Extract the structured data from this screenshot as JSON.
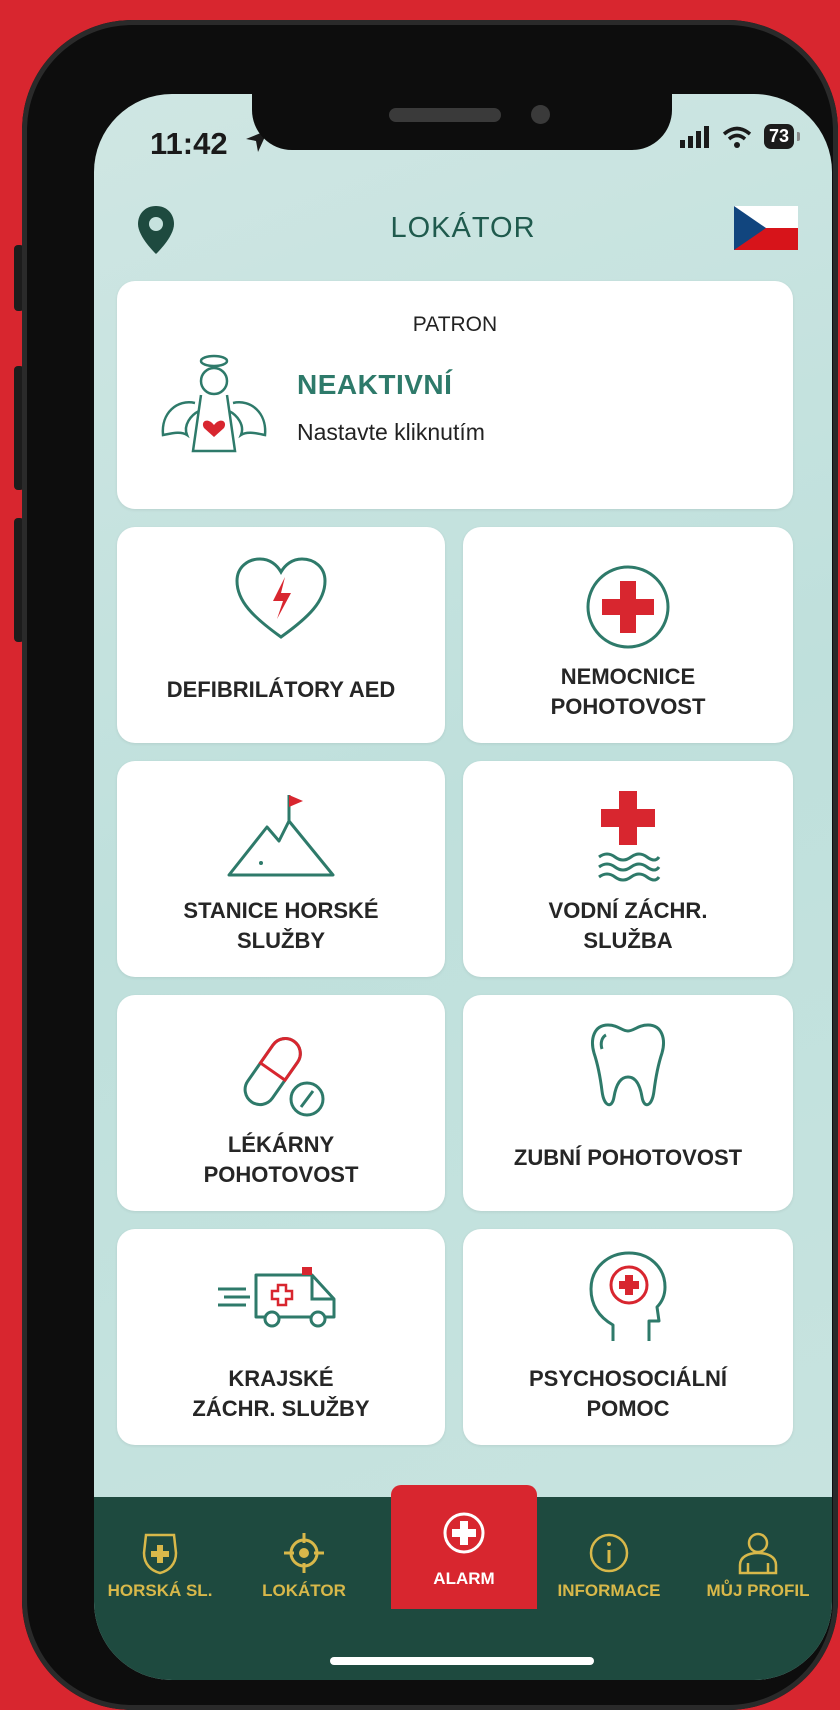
{
  "status": {
    "time": "11:42",
    "battery": "73"
  },
  "header": {
    "title": "LOKÁTOR"
  },
  "patron": {
    "title": "PATRON",
    "state": "NEAKTIVNÍ",
    "hint": "Nastavte kliknutím"
  },
  "tiles": [
    {
      "label": "DEFIBRILÁTORY AED"
    },
    {
      "label": "NEMOCNICE\nPOHOTOVOST"
    },
    {
      "label": "STANICE HORSKÉ\nSLUŽBY"
    },
    {
      "label": "VODNÍ ZÁCHR.\nSLUŽBA"
    },
    {
      "label": "LÉKÁRNY\nPOHOTOVOST"
    },
    {
      "label": "ZUBNÍ POHOTOVOST"
    },
    {
      "label": "KRAJSKÉ\nZÁCHR. SLUŽBY"
    },
    {
      "label": "PSYCHOSOCIÁLNÍ\nPOMOC"
    }
  ],
  "tabbar": {
    "items": [
      {
        "label": "HORSKÁ SL.",
        "icon": "mountain-rescue-badge-icon"
      },
      {
        "label": "LOKÁTOR",
        "icon": "crosshair-icon"
      },
      {
        "label": "ALARM",
        "icon": "medical-cross-icon"
      },
      {
        "label": "INFORMACE",
        "icon": "info-icon"
      },
      {
        "label": "MŮJ PROFIL",
        "icon": "user-icon"
      }
    ],
    "active": "ALARM"
  },
  "colors": {
    "brand_green": "#1e4a3f",
    "accent_red": "#d8262f",
    "tab_label_gold": "#d8b84a",
    "background_mint": "#c6e2de"
  }
}
